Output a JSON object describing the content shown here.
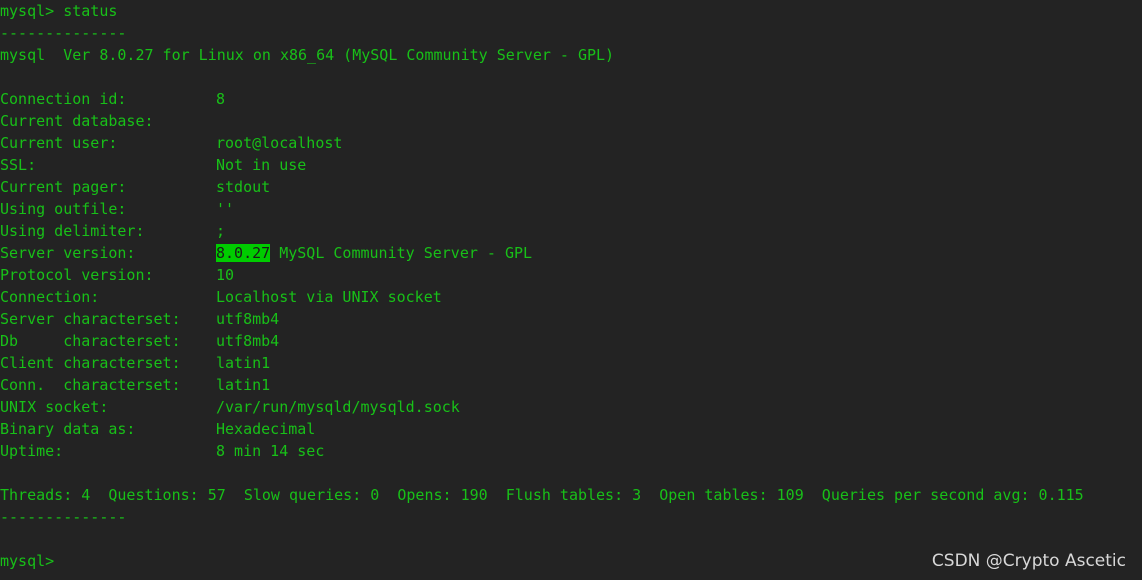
{
  "prompt_line": "mysql> status",
  "separator": "--------------",
  "version_line": "mysql  Ver 8.0.27 for Linux on x86_64 (MySQL Community Server - GPL)",
  "fields": [
    {
      "key": "Connection id:",
      "value": "8"
    },
    {
      "key": "Current database:",
      "value": ""
    },
    {
      "key": "Current user:",
      "value": "root@localhost"
    },
    {
      "key": "SSL:",
      "value": "Not in use"
    },
    {
      "key": "Current pager:",
      "value": "stdout"
    },
    {
      "key": "Using outfile:",
      "value": "''"
    },
    {
      "key": "Using delimiter:",
      "value": ";"
    },
    {
      "key": "Server version:",
      "value_highlight": "8.0.27",
      "value": " MySQL Community Server - GPL"
    },
    {
      "key": "Protocol version:",
      "value": "10"
    },
    {
      "key": "Connection:",
      "value": "Localhost via UNIX socket"
    },
    {
      "key": "Server characterset:",
      "value": "utf8mb4"
    },
    {
      "key": "Db     characterset:",
      "value": "utf8mb4"
    },
    {
      "key": "Client characterset:",
      "value": "latin1"
    },
    {
      "key": "Conn.  characterset:",
      "value": "latin1"
    },
    {
      "key": "UNIX socket:",
      "value": "/var/run/mysqld/mysqld.sock"
    },
    {
      "key": "Binary data as:",
      "value": "Hexadecimal"
    },
    {
      "key": "Uptime:",
      "value": "8 min 14 sec"
    }
  ],
  "stats_line": "Threads: 4  Questions: 57  Slow queries: 0  Opens: 190  Flush tables: 3  Open tables: 109  Queries per second avg: 0.115",
  "final_prompt": "mysql> ",
  "watermark": "CSDN @Crypto Ascetic",
  "colors": {
    "background": "#232323",
    "text": "#18c018",
    "highlight": "#00cc00"
  }
}
